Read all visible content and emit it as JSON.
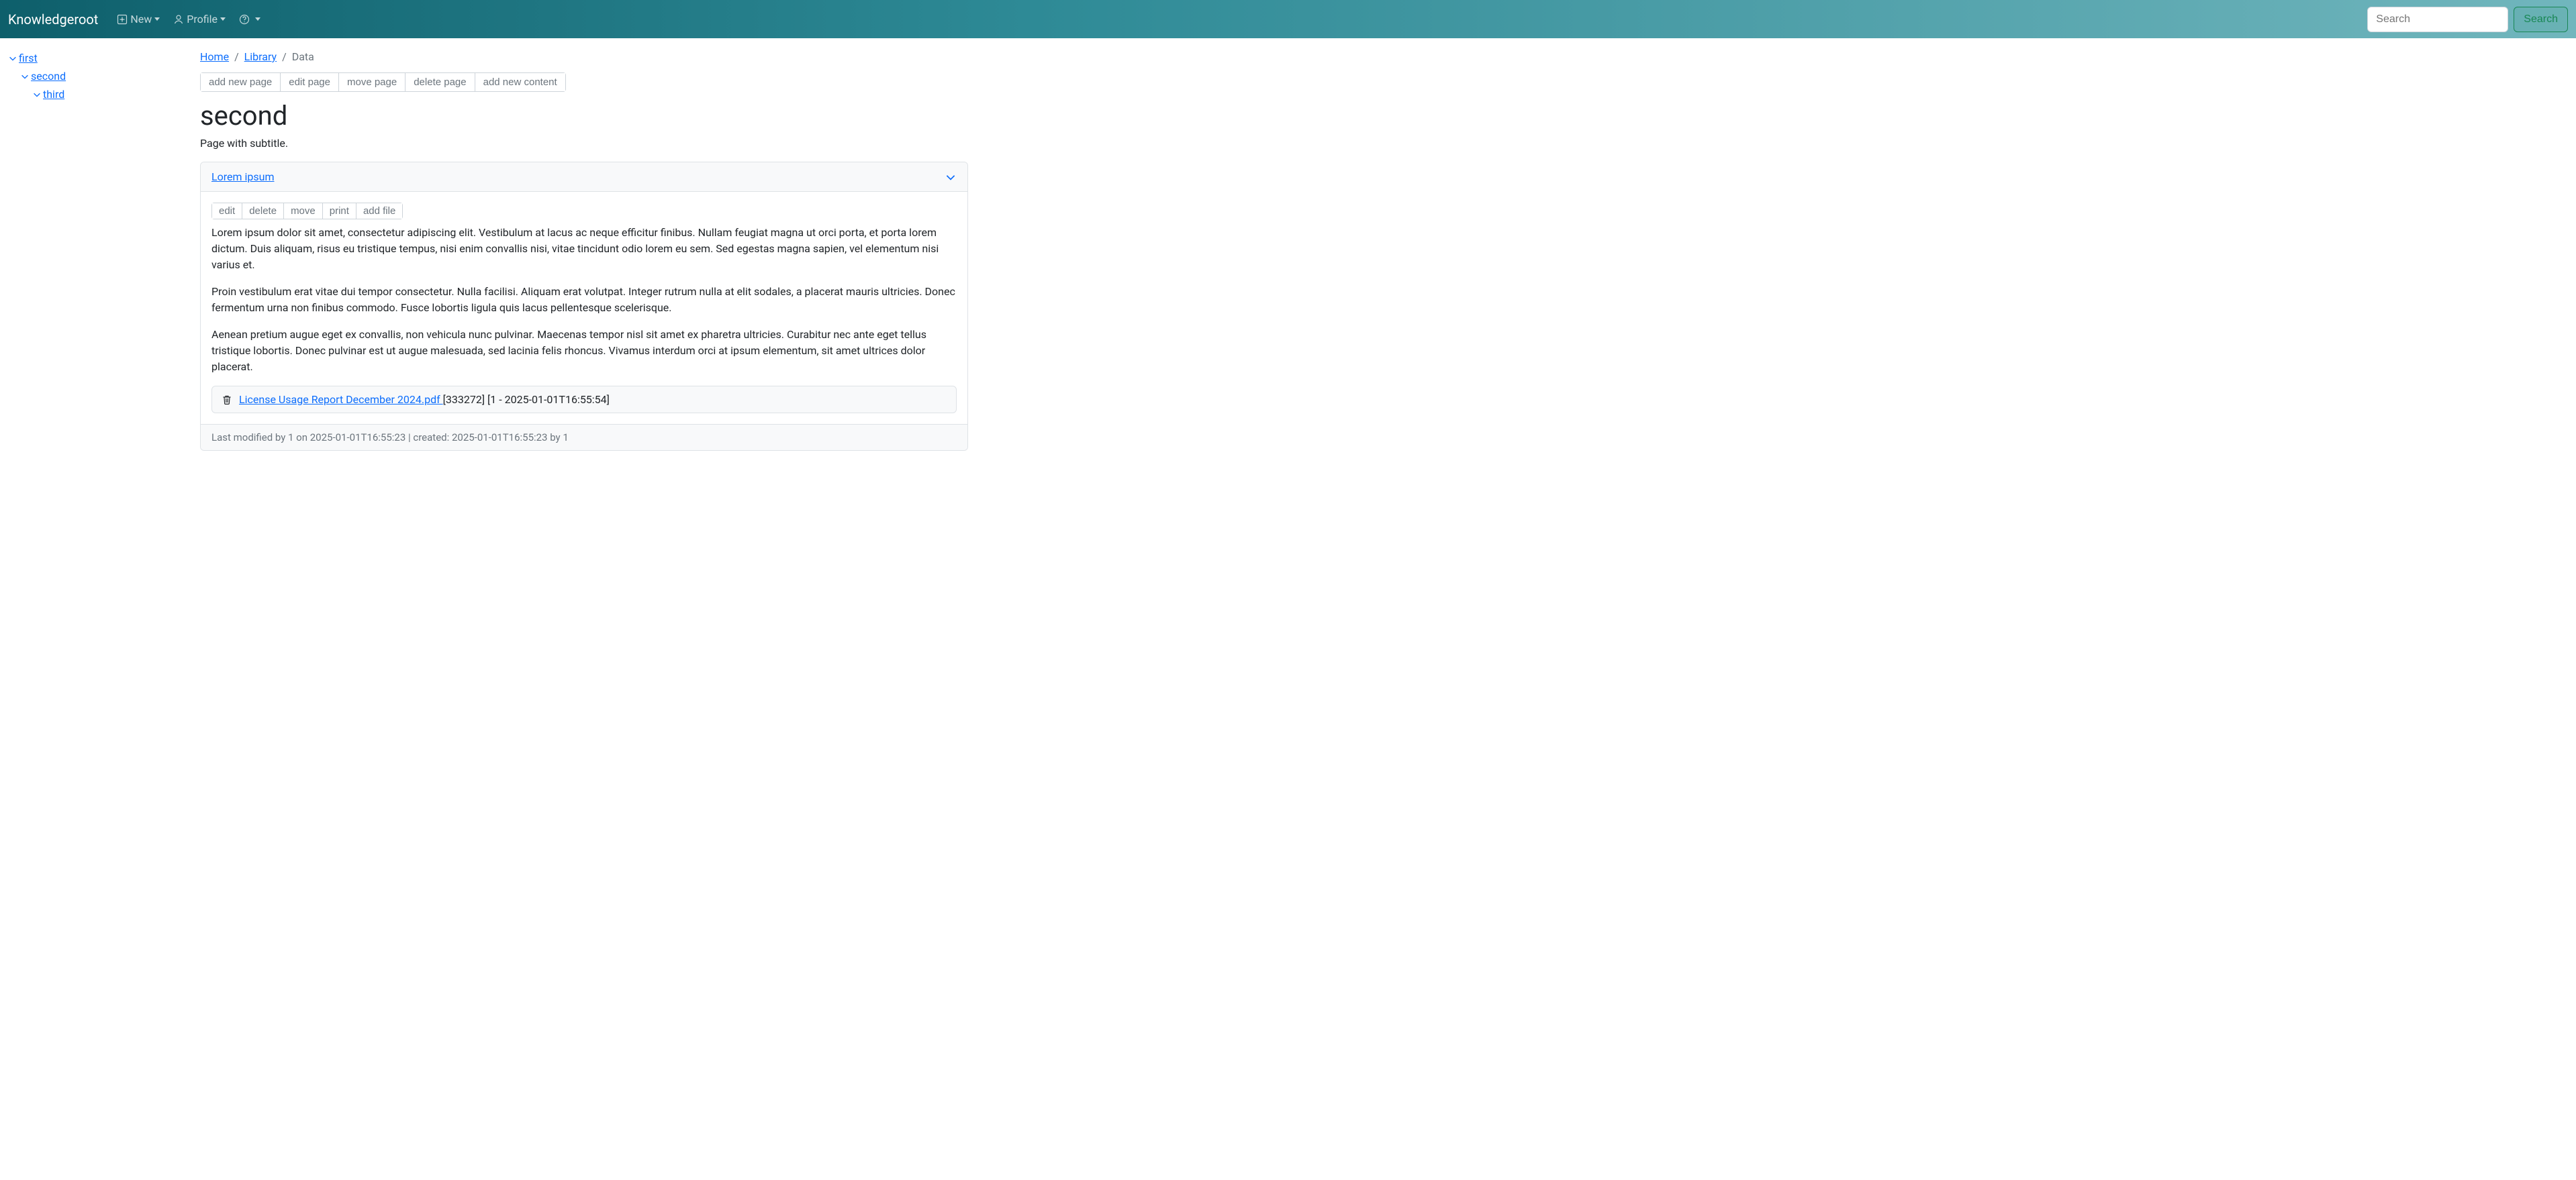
{
  "navbar": {
    "brand": "Knowledgeroot",
    "new_label": "New",
    "profile_label": "Profile",
    "search_placeholder": "Search",
    "search_button": "Search"
  },
  "sidebar": {
    "items": [
      {
        "label": "first"
      },
      {
        "label": "second"
      },
      {
        "label": "third"
      }
    ]
  },
  "breadcrumb": {
    "home": "Home",
    "library": "Library",
    "current": "Data"
  },
  "page_actions": {
    "add_new_page": "add new page",
    "edit_page": "edit page",
    "move_page": "move page",
    "delete_page": "delete page",
    "add_new_content": "add new content"
  },
  "page": {
    "title": "second",
    "subtitle": "Page with subtitle."
  },
  "content": {
    "header_link": "Lorem ipsum",
    "actions": {
      "edit": "edit",
      "delete": "delete",
      "move": "move",
      "print": "print",
      "add_file": "add file"
    },
    "para1": "Lorem ipsum dolor sit amet, consectetur adipiscing elit. Vestibulum at lacus ac neque efficitur finibus. Nullam feugiat magna ut orci porta, et porta lorem dictum. Duis aliquam, risus eu tristique tempus, nisi enim convallis nisi, vitae tincidunt odio lorem eu sem. Sed egestas magna sapien, vel elementum nisi varius et.",
    "para2": "Proin vestibulum erat vitae dui tempor consectetur. Nulla facilisi. Aliquam erat volutpat. Integer rutrum nulla at elit sodales, a placerat mauris ultricies. Donec fermentum urna non finibus commodo. Fusce lobortis ligula quis lacus pellentesque scelerisque.",
    "para3": "Aenean pretium augue eget ex convallis, non vehicula nunc pulvinar. Maecenas tempor nisl sit amet ex pharetra ultricies. Curabitur nec ante eget tellus tristique lobortis. Donec pulvinar est ut augue malesuada, sed lacinia felis rhoncus. Vivamus interdum orci at ipsum elementum, sit amet ultrices dolor placerat.",
    "file": {
      "name": "License Usage Report December 2024.pdf ",
      "meta": "[333272] [1 - 2025-01-01T16:55:54]"
    },
    "footer": "Last modified by 1 on 2025-01-01T16:55:23 | created: 2025-01-01T16:55:23 by 1"
  }
}
